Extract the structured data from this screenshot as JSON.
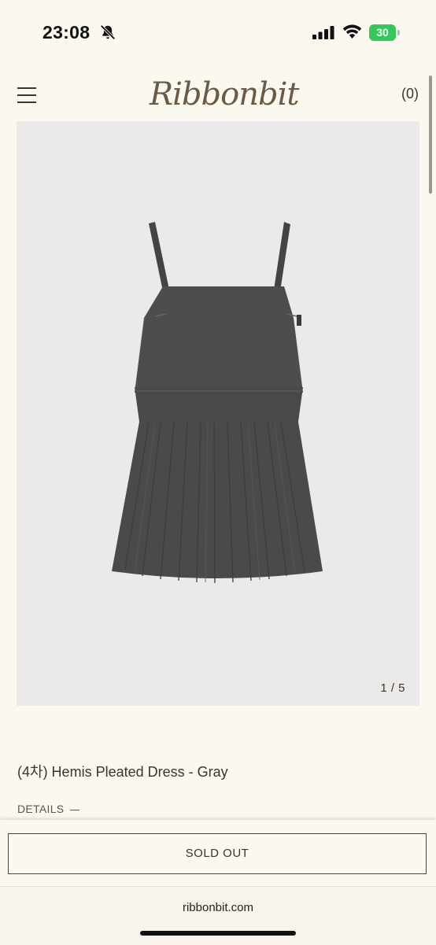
{
  "status_bar": {
    "time": "23:08",
    "battery": "30",
    "icons": [
      "bell-slash-icon",
      "cellular-signal-icon",
      "wifi-icon",
      "battery-icon"
    ]
  },
  "header": {
    "logo": "Ribbonbit",
    "cart_count": "(0)",
    "icons": [
      "hamburger-menu-icon"
    ]
  },
  "product": {
    "image_counter": "1 / 5",
    "title": "(4차) Hemis Pleated Dress - Gray",
    "details_label": "DETAILS"
  },
  "actions": {
    "sold_out_label": "SOLD OUT"
  },
  "browser": {
    "url": "ribbonbit.com"
  },
  "colors": {
    "background": "#fbf8ef",
    "image_background": "#ebeae8",
    "dress": "#4b4b4b",
    "battery": "#34c759"
  }
}
